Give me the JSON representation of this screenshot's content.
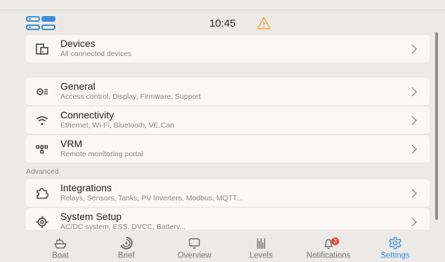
{
  "status_bar": {
    "time": "10:45",
    "left_buttons": [
      "toggle-icon",
      "panels-icon"
    ],
    "warning_icon": "warning-triangle-icon",
    "accent_color": "#3b8fd9",
    "warning_color": "#f0a64a"
  },
  "settings": {
    "devices": {
      "title": "Devices",
      "subtitle": "All connected devices",
      "icon": "devices-icon"
    },
    "general": {
      "title": "General",
      "subtitle": "Access control, Display, Firmware, Support",
      "icon": "general-settings-icon"
    },
    "connectivity": {
      "title": "Connectivity",
      "subtitle": "Ethernet, Wi-Fi, Bluetooth, VE.Can",
      "icon": "wifi-icon"
    },
    "vrm": {
      "title": "VRM",
      "subtitle": "Remote monitoring portal",
      "icon": "vrm-network-icon"
    },
    "advanced_label": "Advanced",
    "integrations": {
      "title": "Integrations",
      "subtitle": "Relays, Sensors, Tanks, PV Inverters, Modbus, MQTT...",
      "icon": "puzzle-icon"
    },
    "system_setup": {
      "title": "System Setup",
      "subtitle": "AC/DC system, ESS, DVCC, Battery...",
      "icon": "system-setup-icon"
    }
  },
  "bottom_nav": {
    "boat": {
      "label": "Boat",
      "icon": "boat-icon"
    },
    "brief": {
      "label": "Brief",
      "icon": "brief-gauge-icon"
    },
    "overview": {
      "label": "Overview",
      "icon": "overview-icon"
    },
    "levels": {
      "label": "Levels",
      "icon": "levels-icon"
    },
    "notifications": {
      "label": "Notifications",
      "icon": "bell-icon",
      "badge": "3"
    },
    "settings": {
      "label": "Settings",
      "icon": "gear-icon",
      "active": true
    }
  }
}
